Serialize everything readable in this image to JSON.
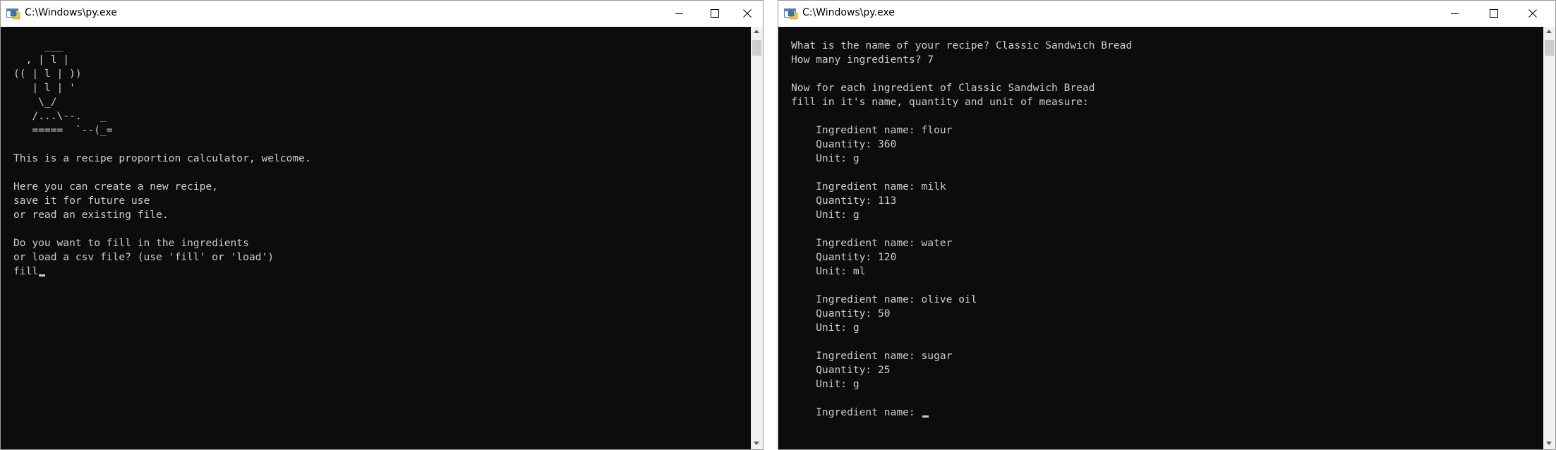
{
  "left_window": {
    "title": "C:\\Windows\\py.exe",
    "icons": {
      "app": "python-console-icon",
      "minimize": "minimize-icon",
      "maximize": "maximize-icon",
      "close": "close-icon"
    },
    "console_text": "     ___\n  , | l |\n(( | l | ))\n   | l | '\n    \\_/\n   /...\\--.   _\n   =====  `--(_=\n\nThis is a recipe proportion calculator, welcome.\n\nHere you can create a new recipe,\nsave it for future use\nor read an existing file.\n\nDo you want to fill in the ingredients\nor load a csv file? (use 'fill' or 'load')\nfill"
  },
  "right_window": {
    "title": "C:\\Windows\\py.exe",
    "icons": {
      "app": "python-console-icon",
      "minimize": "minimize-icon",
      "maximize": "maximize-icon",
      "close": "close-icon"
    },
    "console_text": "What is the name of your recipe? Classic Sandwich Bread\nHow many ingredients? 7\n\nNow for each ingredient of Classic Sandwich Bread\nfill in it's name, quantity and unit of measure:\n\n    Ingredient name: flour\n    Quantity: 360\n    Unit: g\n\n    Ingredient name: milk\n    Quantity: 113\n    Unit: g\n\n    Ingredient name: water\n    Quantity: 120\n    Unit: ml\n\n    Ingredient name: olive oil\n    Quantity: 50\n    Unit: g\n\n    Ingredient name: sugar\n    Quantity: 25\n    Unit: g\n\n    Ingredient name: "
  },
  "colors": {
    "console_bg": "#0c0c0c",
    "console_text": "#cccccc",
    "titlebar_bg": "#ffffff",
    "scrollbar_bg": "#f0f0f0"
  }
}
